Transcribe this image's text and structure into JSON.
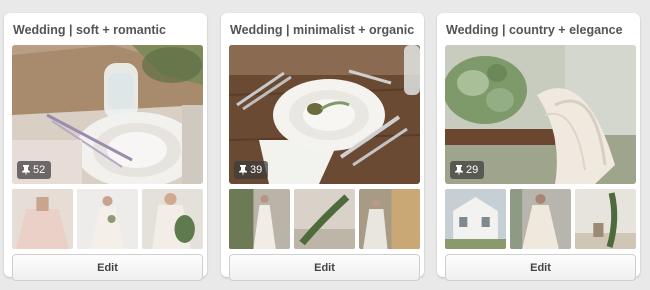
{
  "boards": [
    {
      "title": "Wedding | soft + romantic",
      "pin_count": "52",
      "edit_label": "Edit",
      "cover": "table setting with crystal glass, lace plate and lavender",
      "thumbs": [
        "blush tulle wedding dress",
        "bride in pale gown holding bouquet",
        "bride with greenery bouquet"
      ]
    },
    {
      "title": "Wedding | minimalist + organic",
      "pin_count": "39",
      "edit_label": "Edit",
      "cover": "white plate with silverware and leaf on wooden table",
      "thumbs": [
        "bride beside greenery garland",
        "greenery garland on steps",
        "bride by window"
      ]
    },
    {
      "title": "Wedding | country + elegance",
      "pin_count": "29",
      "edit_label": "Edit",
      "cover": "succulent bouquet with lace veil",
      "thumbs": [
        "white farmhouse reception",
        "bride in lace gown",
        "garland arch outdoors"
      ]
    }
  ],
  "colors": {
    "page_bg": "#e9e9e9",
    "card_bg": "#ffffff",
    "title_text": "#555555",
    "badge_bg": "rgba(60,60,60,0.72)"
  }
}
